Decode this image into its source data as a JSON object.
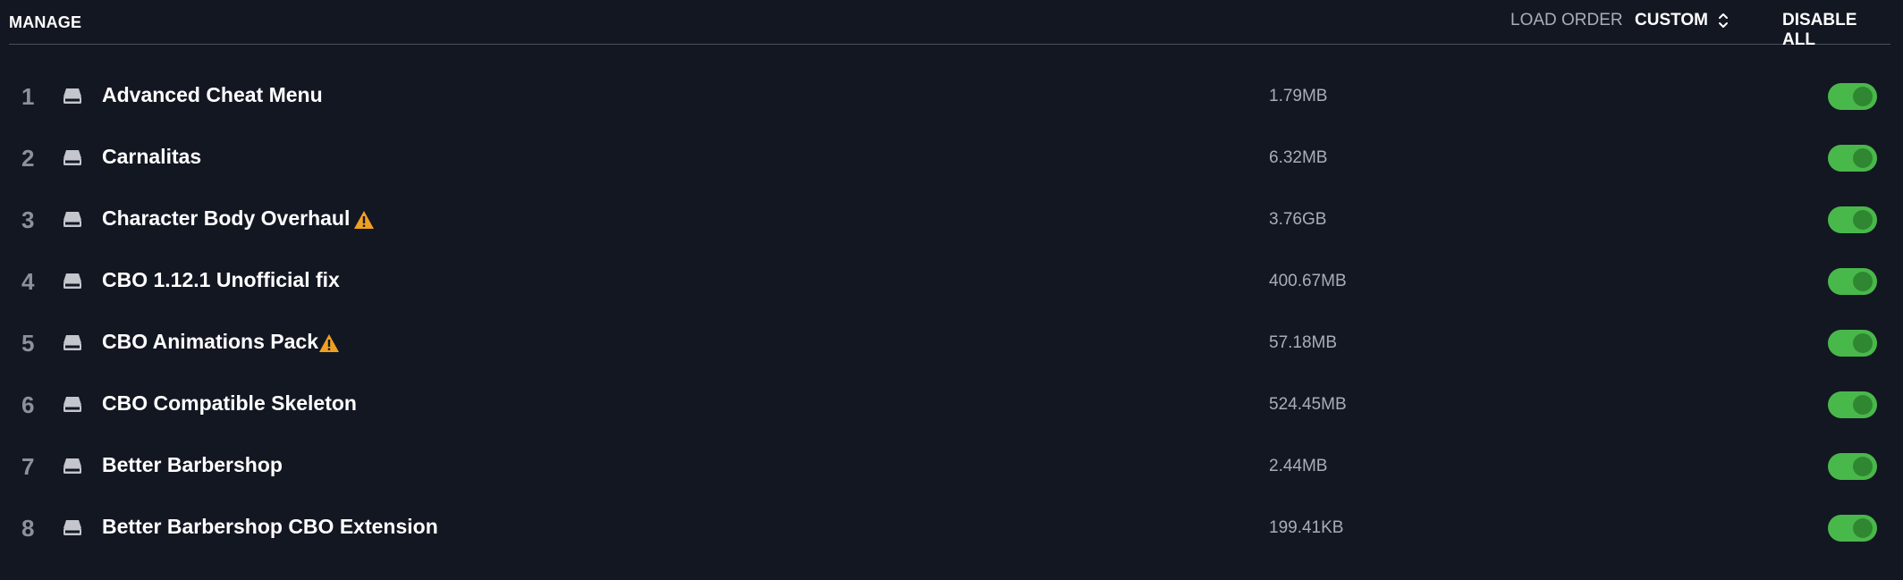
{
  "header": {
    "title": "MANAGE",
    "load_order_label": "LOAD ORDER",
    "load_order_value": "CUSTOM",
    "disable_all_label": "DISABLE ALL"
  },
  "colors": {
    "background": "#131722",
    "toggle_on": "#49b84a",
    "warning": "#f0a020"
  },
  "mods": [
    {
      "index": "1",
      "name": "Advanced Cheat Menu",
      "size": "1.79MB",
      "warning": false,
      "enabled": true
    },
    {
      "index": "2",
      "name": "Carnalitas",
      "size": "6.32MB",
      "warning": false,
      "enabled": true
    },
    {
      "index": "3",
      "name": "Character Body Overhaul",
      "size": "3.76GB",
      "warning": true,
      "enabled": true
    },
    {
      "index": "4",
      "name": "CBO 1.12.1 Unofficial fix",
      "size": "400.67MB",
      "warning": false,
      "enabled": true
    },
    {
      "index": "5",
      "name": "CBO Animations Pack",
      "size": "57.18MB",
      "warning": true,
      "enabled": true
    },
    {
      "index": "6",
      "name": "CBO Compatible Skeleton",
      "size": "524.45MB",
      "warning": false,
      "enabled": true
    },
    {
      "index": "7",
      "name": "Better Barbershop",
      "size": "2.44MB",
      "warning": false,
      "enabled": true
    },
    {
      "index": "8",
      "name": "Better Barbershop CBO Extension",
      "size": "199.41KB",
      "warning": false,
      "enabled": true
    }
  ]
}
